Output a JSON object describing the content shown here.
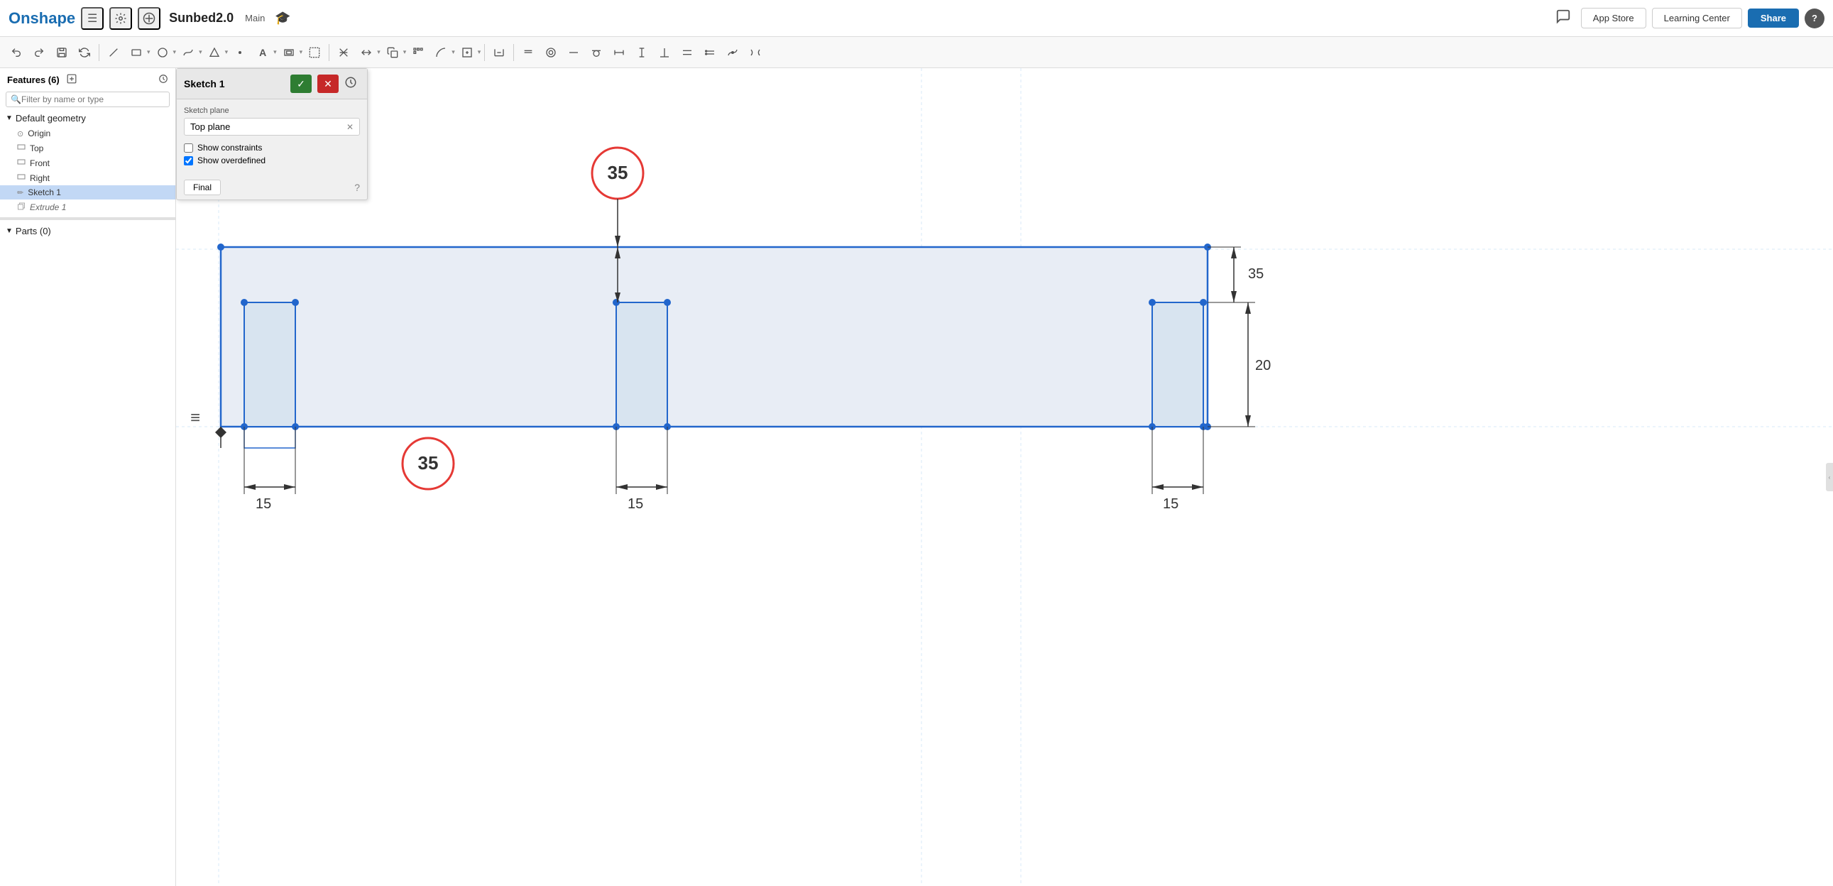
{
  "header": {
    "logo": "Onshape",
    "menu_icon": "☰",
    "settings_icon": "⚙",
    "add_icon": "+",
    "doc_title": "Sunbed2.0",
    "doc_branch": "Main",
    "grad_icon": "🎓",
    "comment_icon": "💬",
    "app_store_label": "App Store",
    "learning_center_label": "Learning Center",
    "share_label": "Share",
    "help_label": "?"
  },
  "toolbar": {
    "tools": [
      "↩",
      "↪",
      "💾",
      "🔄",
      "✏",
      "⬜",
      "⬤",
      "~",
      "⬡",
      "✦",
      "A",
      "⬛",
      "⊞",
      "⌒",
      "✂",
      "⎘",
      "📊",
      "⬡",
      "📄",
      "↔",
      "⌒",
      "⬤",
      "✕",
      "⌐",
      "—",
      "|",
      "⊥",
      "=",
      "…",
      "⌒",
      "⌒"
    ]
  },
  "sidebar": {
    "features_header": "Features (6)",
    "search_placeholder": "Filter by name or type",
    "default_geometry_label": "Default geometry",
    "items": [
      {
        "id": "origin",
        "label": "Origin",
        "icon": "⊙",
        "type": "origin"
      },
      {
        "id": "top",
        "label": "Top",
        "icon": "▭",
        "type": "plane"
      },
      {
        "id": "front",
        "label": "Front",
        "icon": "▭",
        "type": "plane"
      },
      {
        "id": "right",
        "label": "Right",
        "icon": "▭",
        "type": "plane"
      },
      {
        "id": "sketch1",
        "label": "Sketch 1",
        "icon": "✏",
        "type": "sketch",
        "active": true
      },
      {
        "id": "extrude1",
        "label": "Extrude 1",
        "icon": "⬡",
        "type": "extrude",
        "italic": true
      }
    ],
    "parts_header": "Parts (0)"
  },
  "sketch_panel": {
    "title": "Sketch 1",
    "confirm_icon": "✓",
    "cancel_icon": "✕",
    "plane_label": "Sketch plane",
    "plane_value": "Top plane",
    "show_constraints_label": "Show constraints",
    "show_constraints_checked": false,
    "show_overdefined_label": "Show overdefined",
    "show_overdefined_checked": true,
    "final_label": "Final",
    "help_icon": "?"
  },
  "canvas": {
    "dimensions": {
      "d35_top": "35",
      "d35_right": "35",
      "d35_circle1": "35",
      "d35_circle2": "35",
      "d20": "20",
      "d15_left": "15",
      "d15_mid": "15",
      "d15_right": "15"
    }
  }
}
